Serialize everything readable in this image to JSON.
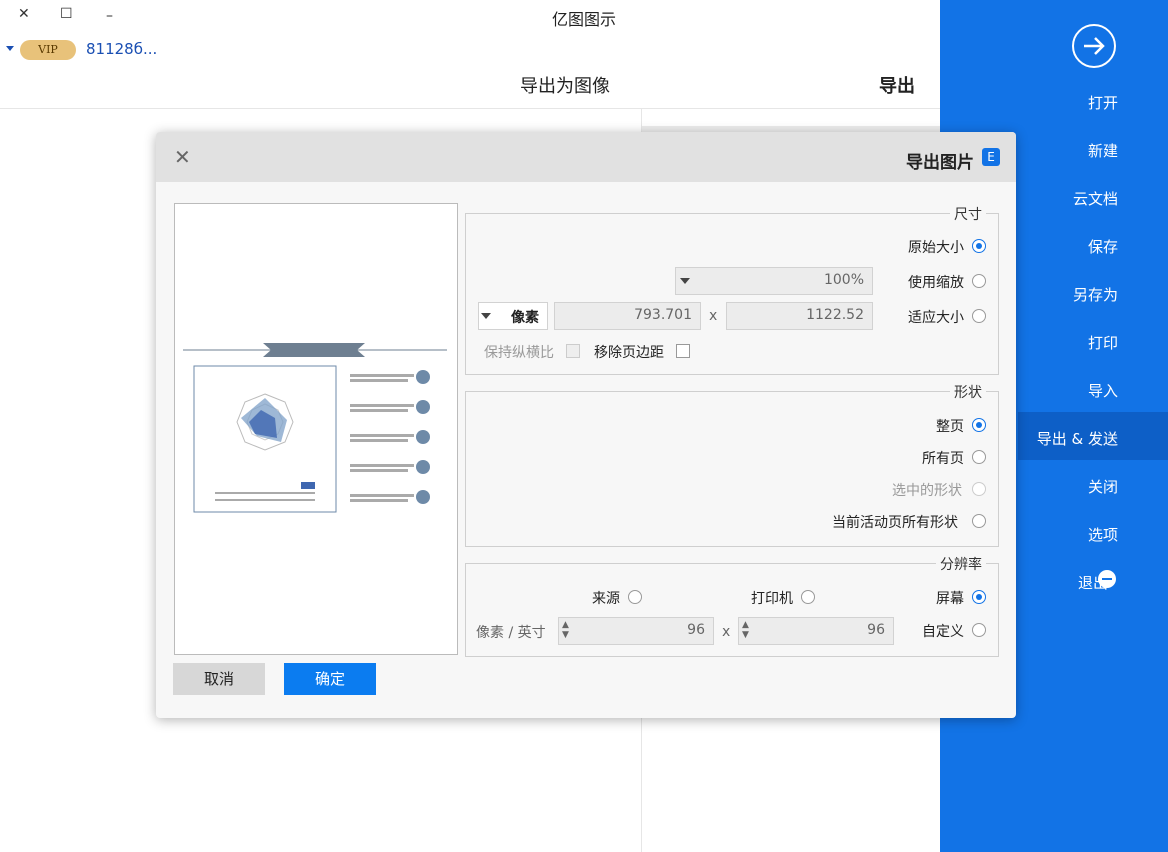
{
  "window": {
    "title": "亿图图示",
    "close_glyph": "✕",
    "maximize_glyph": "☐",
    "minimize_glyph": "–"
  },
  "account": {
    "vip_label": "VIP",
    "user_id": "81128б..."
  },
  "header": {
    "section_title": "导出",
    "panel_title": "导出为图像"
  },
  "sidebar": {
    "bg_color": "#1273e6",
    "items": [
      {
        "label": "打开"
      },
      {
        "label": "新建"
      },
      {
        "label": "云文档"
      },
      {
        "label": "保存"
      },
      {
        "label": "另存为"
      },
      {
        "label": "打印"
      },
      {
        "label": "导入"
      },
      {
        "label": "导出 & 发送",
        "active": true
      },
      {
        "label": "关闭"
      },
      {
        "label": "选项"
      },
      {
        "label": "退出"
      }
    ]
  },
  "dialog": {
    "title": "导出图片",
    "close_glyph": "✕",
    "size_section": {
      "legend": "尺寸",
      "options": [
        {
          "label": "原始大小",
          "checked": true
        },
        {
          "label": "使用缩放",
          "checked": false
        },
        {
          "label": "适应大小",
          "checked": false
        }
      ],
      "zoom_value": "100%",
      "width_value": "1122.52",
      "x_sep": "x",
      "height_value": "793.701",
      "unit_value": "像素",
      "remove_margin_label": "移除页边距",
      "keep_ratio_label": "保持纵横比"
    },
    "shape_section": {
      "legend": "形状",
      "options": [
        {
          "label": "整页",
          "checked": true
        },
        {
          "label": "所有页",
          "checked": false
        },
        {
          "label": "选中的形状",
          "checked": false,
          "disabled": true
        },
        {
          "label": "当前活动页所有形状",
          "checked": false
        }
      ]
    },
    "resolution_section": {
      "legend": "分辨率",
      "options": [
        {
          "label": "屏幕",
          "checked": true
        },
        {
          "label": "打印机",
          "checked": false
        },
        {
          "label": "来源",
          "checked": false
        },
        {
          "label": "自定义",
          "checked": false
        }
      ],
      "dpi_x": "96",
      "x_sep": "x",
      "dpi_y": "96",
      "unit_label": "像素 / 英寸"
    },
    "ok_label": "确定",
    "cancel_label": "取消",
    "ok_color": "#0b7cf0"
  }
}
